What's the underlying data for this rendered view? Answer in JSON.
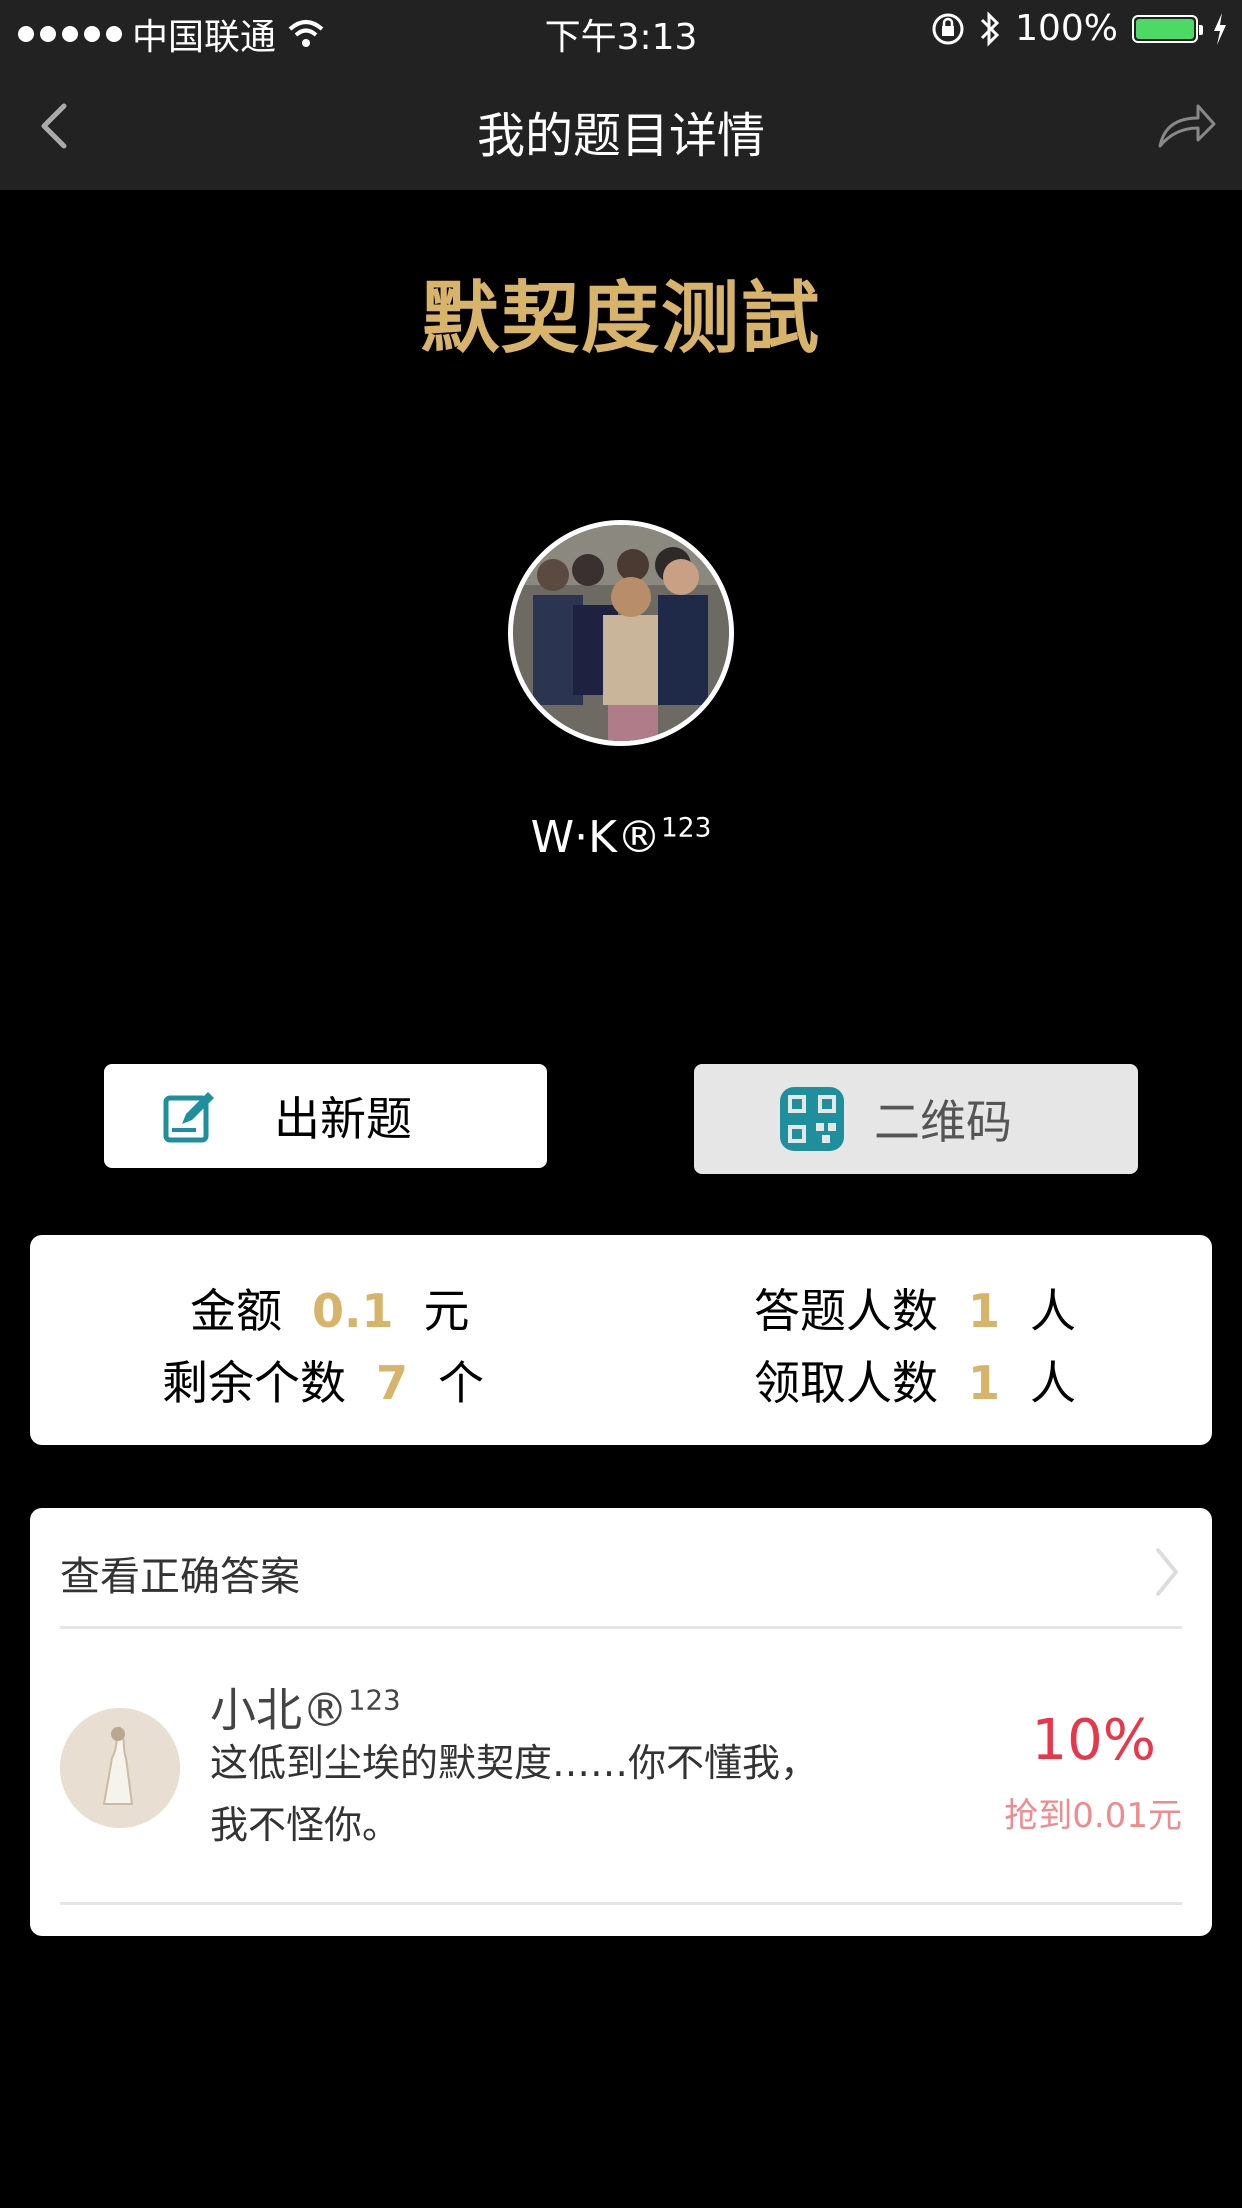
{
  "status_bar": {
    "carrier": "中国联通",
    "time": "下午3:13",
    "battery": "100%"
  },
  "nav": {
    "title": "我的题目详情",
    "back_icon": "chevron-left-icon",
    "share_icon": "share-icon"
  },
  "headline": "默契度测試",
  "profile": {
    "username": "W·K®",
    "username_sup": "123"
  },
  "actions": {
    "new_question": "出新题",
    "qr_code": "二维码"
  },
  "stats": {
    "amount_label": "金额",
    "amount_value": "0.1",
    "amount_unit": "元",
    "answered_label": "答题人数",
    "answered_value": "1",
    "answered_unit": "人",
    "remaining_label": "剩余个数",
    "remaining_value": "7",
    "remaining_unit": "个",
    "claimed_label": "领取人数",
    "claimed_value": "1",
    "claimed_unit": "人"
  },
  "answers": {
    "view_label": "查看正确答案",
    "comments": [
      {
        "user": "小北®",
        "user_sup": "123",
        "text": "这低到尘埃的默契度……你不懂我，我不怪你。",
        "percent": "10%",
        "grabbed": "抢到0.01元"
      }
    ]
  },
  "colors": {
    "accent_gold": "#d8b46a",
    "percent_red": "#e8374a",
    "qr_teal": "#1f8f9e"
  }
}
